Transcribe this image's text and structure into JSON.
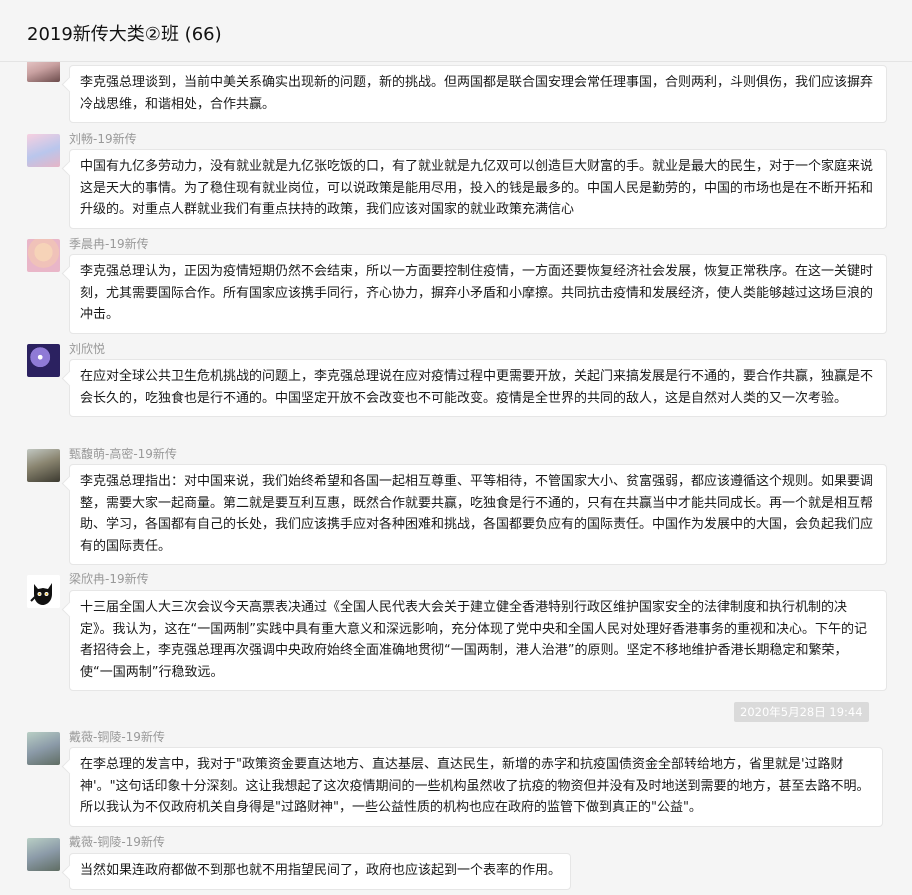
{
  "header": {
    "title": "2019新传大类②班 (66)"
  },
  "messages": [
    {
      "sender": "",
      "avatar_icon": "user-avatar-icon",
      "text": "李克强总理谈到，当前中美关系确实出现新的问题，新的挑战。但两国都是联合国安理会常任理事国，合则两利，斗则俱伤，我们应该摒弃冷战思维，和谐相处，合作共赢。"
    },
    {
      "sender": "刘畅-19新传",
      "avatar_icon": "user-avatar-icon",
      "text": "中国有九亿多劳动力，没有就业就是九亿张吃饭的口，有了就业就是九亿双可以创造巨大财富的手。就业是最大的民生，对于一个家庭来说这是天大的事情。为了稳住现有就业岗位，可以说政策是能用尽用，投入的钱是最多的。中国人民是勤劳的，中国的市场也是在不断开拓和升级的。对重点人群就业我们有重点扶持的政策，我们应该对国家的就业政策充满信心"
    },
    {
      "sender": "季晨冉-19新传",
      "avatar_icon": "user-avatar-icon",
      "text": "李克强总理认为，正因为疫情短期仍然不会结束，所以一方面要控制住疫情，一方面还要恢复经济社会发展，恢复正常秩序。在这一关键时刻，尤其需要国际合作。所有国家应该携手同行，齐心协力，摒弃小矛盾和小摩擦。共同抗击疫情和发展经济，使人类能够越过这场巨浪的冲击。"
    },
    {
      "sender": "刘欣悦",
      "avatar_icon": "user-avatar-icon",
      "text": "在应对全球公共卫生危机挑战的问题上，李克强总理说在应对疫情过程中更需要开放，关起门来搞发展是行不通的，要合作共赢，独赢是不会长久的，吃独食也是行不通的。中国坚定开放不会改变也不可能改变。疫情是全世界的共同的敌人，这是自然对人类的又一次考验。"
    },
    {
      "sender": "甄馥萌-高密-19新传",
      "avatar_icon": "user-avatar-icon",
      "text": "李克强总理指出：对中国来说，我们始终希望和各国一起相互尊重、平等相待，不管国家大小、贫富强弱，都应该遵循这个规则。如果要调整，需要大家一起商量。第二就是要互利互惠，既然合作就要共赢，吃独食是行不通的，只有在共赢当中才能共同成长。再一个就是相互帮助、学习，各国都有自己的长处，我们应该携手应对各种困难和挑战，各国都要负应有的国际责任。中国作为发展中的大国，会负起我们应有的国际责任。"
    },
    {
      "sender": "梁欣冉-19新传",
      "avatar_icon": "black-cat-avatar-icon",
      "text": "十三届全国人大三次会议今天高票表决通过《全国人民代表大会关于建立健全香港特别行政区维护国家安全的法律制度和执行机制的决定》。我认为，这在“一国两制”实践中具有重大意义和深远影响，充分体现了党中央和全国人民对处理好香港事务的重视和决心。下午的记者招待会上，李克强总理再次强调中央政府始终全面准确地贯彻“一国两制，港人治港”的原则。坚定不移地维护香港长期稳定和繁荣，使“一国两制”行稳致远。"
    },
    {
      "sender": "戴薇-铜陵-19新传",
      "avatar_icon": "hamster-avatar-icon",
      "text": "在李总理的发言中，我对于\"政策资金要直达地方、直达基层、直达民生，新增的赤字和抗疫国债资金全部转给地方，省里就是'过路财神'。\"这句话印象十分深刻。这让我想起了这次疫情期间的一些机构虽然收了抗疫的物资但并没有及时地送到需要的地方，甚至去路不明。所以我认为不仅政府机关自身得是\"过路财神\"，一些公益性质的机构也应在政府的监管下做到真正的\"公益\"。"
    },
    {
      "sender": "戴薇-铜陵-19新传",
      "avatar_icon": "hamster-avatar-icon",
      "text": "当然如果连政府都做不到那也就不用指望民间了，政府也应该起到一个表率的作用。"
    }
  ],
  "timestamp": "2020年5月28日 19:44",
  "colors": {
    "bubble_bg": "#ffffff",
    "page_bg": "#f5f5f5",
    "timestamp_bg": "#dadada"
  }
}
